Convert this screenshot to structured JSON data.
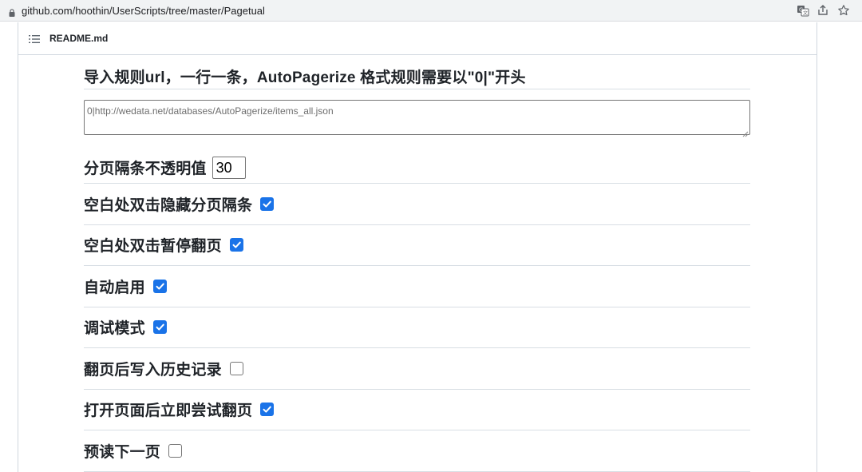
{
  "browser": {
    "url": "github.com/hoothin/UserScripts/tree/master/Pagetual",
    "icons": [
      "lock-icon",
      "translate-icon",
      "share-icon",
      "bookmark-star-icon"
    ]
  },
  "readme": {
    "filename": "README.md"
  },
  "settings": {
    "import_heading": "导入规则url，一行一条，AutoPagerize 格式规则需要以\"0|\"开头",
    "import_rules_value": "0|http://wedata.net/databases/AutoPagerize/items_all.json",
    "opacity_label": "分页隔条不透明值",
    "opacity_value": "30",
    "options": [
      {
        "label": "空白处双击隐藏分页隔条",
        "checked": true
      },
      {
        "label": "空白处双击暂停翻页",
        "checked": true
      },
      {
        "label": "自动启用",
        "checked": true
      },
      {
        "label": "调试模式",
        "checked": true
      },
      {
        "label": "翻页后写入历史记录",
        "checked": false
      },
      {
        "label": "打开页面后立即尝试翻页",
        "checked": true
      },
      {
        "label": "预读下一页",
        "checked": false
      }
    ]
  },
  "colors": {
    "checkbox_checked": "#1a73e8",
    "divider": "#d8dee4"
  }
}
